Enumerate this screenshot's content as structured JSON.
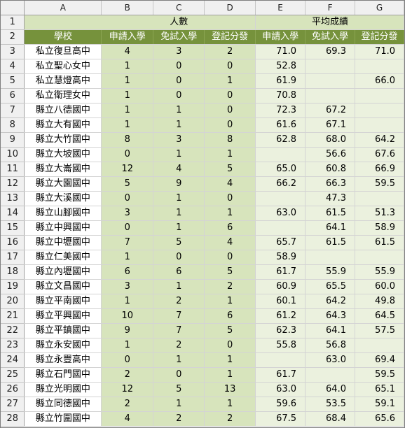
{
  "columns": [
    "A",
    "B",
    "C",
    "D",
    "E",
    "F",
    "G"
  ],
  "header": {
    "group_count": "人數",
    "group_avg": "平均成績",
    "school_label": "學校",
    "sub_labels": [
      "申請入學",
      "免試入學",
      "登記分發",
      "申請入學",
      "免試入學",
      "登記分發"
    ]
  },
  "rows": [
    {
      "num": "3",
      "school": "私立復旦高中",
      "c1": "4",
      "c2": "3",
      "c3": "2",
      "a1": "71.0",
      "a2": "69.3",
      "a3": "71.0"
    },
    {
      "num": "4",
      "school": "私立聖心女中",
      "c1": "1",
      "c2": "0",
      "c3": "0",
      "a1": "52.8",
      "a2": "",
      "a3": ""
    },
    {
      "num": "5",
      "school": "私立慧燈高中",
      "c1": "1",
      "c2": "0",
      "c3": "1",
      "a1": "61.9",
      "a2": "",
      "a3": "66.0"
    },
    {
      "num": "6",
      "school": "私立衛理女中",
      "c1": "1",
      "c2": "0",
      "c3": "0",
      "a1": "70.8",
      "a2": "",
      "a3": ""
    },
    {
      "num": "7",
      "school": "縣立八德國中",
      "c1": "1",
      "c2": "1",
      "c3": "0",
      "a1": "72.3",
      "a2": "67.2",
      "a3": ""
    },
    {
      "num": "8",
      "school": "縣立大有國中",
      "c1": "1",
      "c2": "1",
      "c3": "0",
      "a1": "61.6",
      "a2": "67.1",
      "a3": ""
    },
    {
      "num": "9",
      "school": "縣立大竹國中",
      "c1": "8",
      "c2": "3",
      "c3": "8",
      "a1": "62.8",
      "a2": "68.0",
      "a3": "64.2"
    },
    {
      "num": "10",
      "school": "縣立大坡國中",
      "c1": "0",
      "c2": "1",
      "c3": "1",
      "a1": "",
      "a2": "56.6",
      "a3": "67.6"
    },
    {
      "num": "11",
      "school": "縣立大崙國中",
      "c1": "12",
      "c2": "4",
      "c3": "5",
      "a1": "65.0",
      "a2": "60.8",
      "a3": "66.9"
    },
    {
      "num": "12",
      "school": "縣立大園國中",
      "c1": "5",
      "c2": "9",
      "c3": "4",
      "a1": "66.2",
      "a2": "66.3",
      "a3": "59.5"
    },
    {
      "num": "13",
      "school": "縣立大溪國中",
      "c1": "0",
      "c2": "1",
      "c3": "0",
      "a1": "",
      "a2": "47.3",
      "a3": ""
    },
    {
      "num": "14",
      "school": "縣立山腳國中",
      "c1": "3",
      "c2": "1",
      "c3": "1",
      "a1": "63.0",
      "a2": "61.5",
      "a3": "51.3"
    },
    {
      "num": "15",
      "school": "縣立中興國中",
      "c1": "0",
      "c2": "1",
      "c3": "6",
      "a1": "",
      "a2": "64.1",
      "a3": "58.9"
    },
    {
      "num": "16",
      "school": "縣立中壢國中",
      "c1": "7",
      "c2": "5",
      "c3": "4",
      "a1": "65.7",
      "a2": "61.5",
      "a3": "61.5"
    },
    {
      "num": "17",
      "school": "縣立仁美國中",
      "c1": "1",
      "c2": "0",
      "c3": "0",
      "a1": "58.9",
      "a2": "",
      "a3": ""
    },
    {
      "num": "18",
      "school": "縣立內壢國中",
      "c1": "6",
      "c2": "6",
      "c3": "5",
      "a1": "61.7",
      "a2": "55.9",
      "a3": "55.9"
    },
    {
      "num": "19",
      "school": "縣立文昌國中",
      "c1": "3",
      "c2": "1",
      "c3": "2",
      "a1": "60.9",
      "a2": "65.5",
      "a3": "60.0"
    },
    {
      "num": "20",
      "school": "縣立平南國中",
      "c1": "1",
      "c2": "2",
      "c3": "1",
      "a1": "60.1",
      "a2": "64.2",
      "a3": "49.8"
    },
    {
      "num": "21",
      "school": "縣立平興國中",
      "c1": "10",
      "c2": "7",
      "c3": "6",
      "a1": "61.2",
      "a2": "64.3",
      "a3": "64.5"
    },
    {
      "num": "22",
      "school": "縣立平鎮國中",
      "c1": "9",
      "c2": "7",
      "c3": "5",
      "a1": "62.3",
      "a2": "64.1",
      "a3": "57.5"
    },
    {
      "num": "23",
      "school": "縣立永安國中",
      "c1": "1",
      "c2": "2",
      "c3": "0",
      "a1": "55.8",
      "a2": "56.8",
      "a3": ""
    },
    {
      "num": "24",
      "school": "縣立永豐高中",
      "c1": "0",
      "c2": "1",
      "c3": "1",
      "a1": "",
      "a2": "63.0",
      "a3": "69.4"
    },
    {
      "num": "25",
      "school": "縣立石門國中",
      "c1": "2",
      "c2": "0",
      "c3": "1",
      "a1": "61.7",
      "a2": "",
      "a3": "59.5"
    },
    {
      "num": "26",
      "school": "縣立光明國中",
      "c1": "12",
      "c2": "5",
      "c3": "13",
      "a1": "63.0",
      "a2": "64.0",
      "a3": "65.1"
    },
    {
      "num": "27",
      "school": "縣立同德國中",
      "c1": "2",
      "c2": "1",
      "c3": "1",
      "a1": "59.6",
      "a2": "53.5",
      "a3": "59.1"
    },
    {
      "num": "28",
      "school": "縣立竹圍國中",
      "c1": "4",
      "c2": "2",
      "c3": "2",
      "a1": "67.5",
      "a2": "68.4",
      "a3": "65.6"
    }
  ]
}
